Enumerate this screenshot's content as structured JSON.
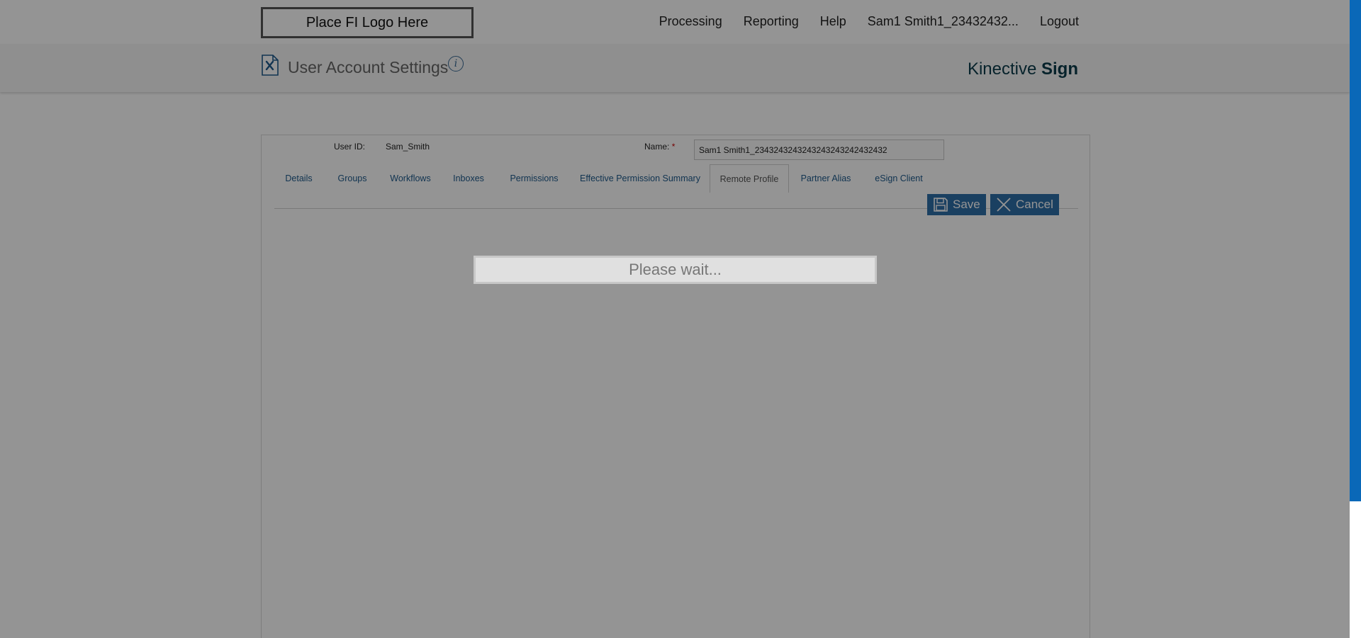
{
  "header": {
    "logo_text": "Place FI Logo Here",
    "nav": [
      "Processing",
      "Reporting",
      "Help",
      "Sam1 Smith1_23432432...",
      "Logout"
    ]
  },
  "subheader": {
    "title": "User Account Settings",
    "info_glyph": "i",
    "brand_regular": "Kinective ",
    "brand_bold": "Sign"
  },
  "form": {
    "user_id_label": "User ID:",
    "user_id_value": "Sam_Smith",
    "name_label": "Name:",
    "name_required": "*",
    "name_value": "Sam1 Smith1_2343243243243243243242432432"
  },
  "tabs": [
    {
      "label": "Details",
      "active": false
    },
    {
      "label": "Groups",
      "active": false
    },
    {
      "label": "Workflows",
      "active": false
    },
    {
      "label": "Inboxes",
      "active": false
    },
    {
      "label": "Permissions",
      "active": false
    },
    {
      "label": "Effective Permission Summary",
      "active": false
    },
    {
      "label": "Remote Profile",
      "active": true
    },
    {
      "label": "Partner Alias",
      "active": false
    },
    {
      "label": "eSign Client",
      "active": false
    }
  ],
  "actions": {
    "save_label": "Save",
    "cancel_label": "Cancel"
  },
  "overlay": {
    "wait_text": "Please wait..."
  },
  "colors": {
    "accent": "#2e6ea8",
    "link": "#1e5a8c",
    "scrollbar": "#0a68b8"
  }
}
